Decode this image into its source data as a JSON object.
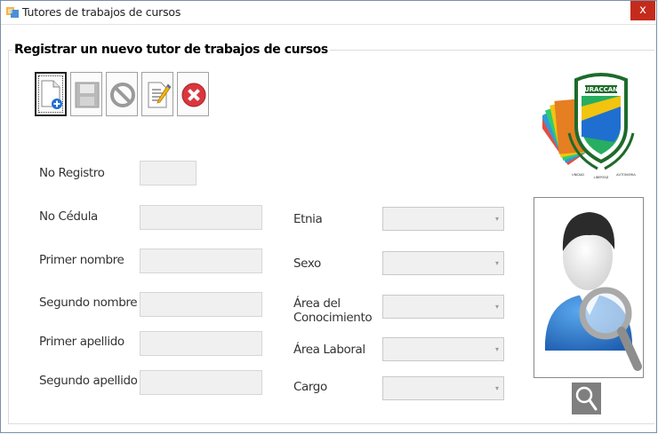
{
  "window": {
    "title": "Tutores de trabajos de cursos",
    "close_glyph": "x"
  },
  "group": {
    "legend": "Registrar un nuevo tutor de trabajos de cursos"
  },
  "toolbar": {
    "buttons": [
      {
        "name": "new-document-icon"
      },
      {
        "name": "save-icon"
      },
      {
        "name": "cancel-icon"
      },
      {
        "name": "edit-icon"
      },
      {
        "name": "delete-icon"
      }
    ]
  },
  "form": {
    "left_labels": {
      "no_registro": "No Registro",
      "no_cedula": "No Cédula",
      "primer_nombre": "Primer nombre",
      "segundo_nombre": "Segundo nombre",
      "primer_apellido": "Primer apellido",
      "segundo_apellido": "Segundo apellido"
    },
    "right_labels": {
      "etnia": "Etnia",
      "sexo": "Sexo",
      "area_conocimiento_1": "Área del",
      "area_conocimiento_2": "Conocimiento",
      "area_laboral": "Área Laboral",
      "cargo": "Cargo"
    },
    "values": {
      "no_registro": "",
      "no_cedula": "",
      "primer_nombre": "",
      "segundo_nombre": "",
      "primer_apellido": "",
      "segundo_apellido": "",
      "etnia": "",
      "sexo": "",
      "area_conocimiento": "",
      "area_laboral": "",
      "cargo": ""
    }
  },
  "logo": {
    "name": "URACCAN",
    "left_motto": "UNIDAD",
    "right_motto": "AUTONOMIA",
    "bottom_motto": "LIBERTAD"
  },
  "icons": {
    "photo": "user-search-icon",
    "search": "magnifier-icon"
  },
  "colors": {
    "close": "#c42b1c",
    "delete": "#d9363e",
    "user_blue": "#2f7fd0",
    "search_button": "#7f7f7f"
  }
}
